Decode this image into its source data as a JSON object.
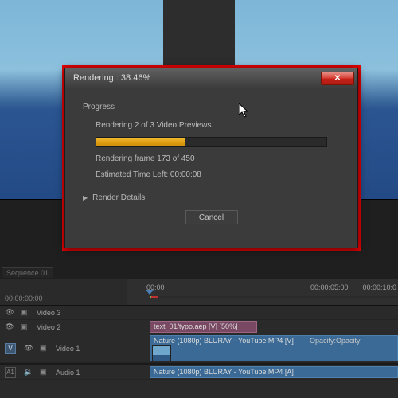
{
  "dialog": {
    "title": "Rendering : 38.46%",
    "section": "Progress",
    "status_preview": "Rendering 2 of 3 Video Previews",
    "status_frame": "Rendering frame 173 of 450",
    "status_time": "Estimated Time Left: 00:00:08",
    "render_details": "Render Details",
    "cancel": "Cancel",
    "progress_percent": 38.46
  },
  "timeline": {
    "timecode": "00:00:00:00",
    "ruler": {
      "t0": "00:00",
      "t1": "00:00:05:00",
      "t2": "00:00:10:0"
    },
    "tracks": {
      "v3": "Video 3",
      "v2": "Video 2",
      "v1": "Video 1",
      "a1": "Audio 1",
      "sel_v": "V",
      "sel_a": "A1"
    },
    "clips": {
      "typo": "text_01/typo.aep [V] [50%]",
      "nature_v": "Nature (1080p) BLURAY - YouTube.MP4 [V]",
      "opacity": "Opacity:Opacity",
      "nature_a": "Nature (1080p) BLURAY - YouTube.MP4 [A]"
    },
    "tab": "Sequence 01"
  }
}
